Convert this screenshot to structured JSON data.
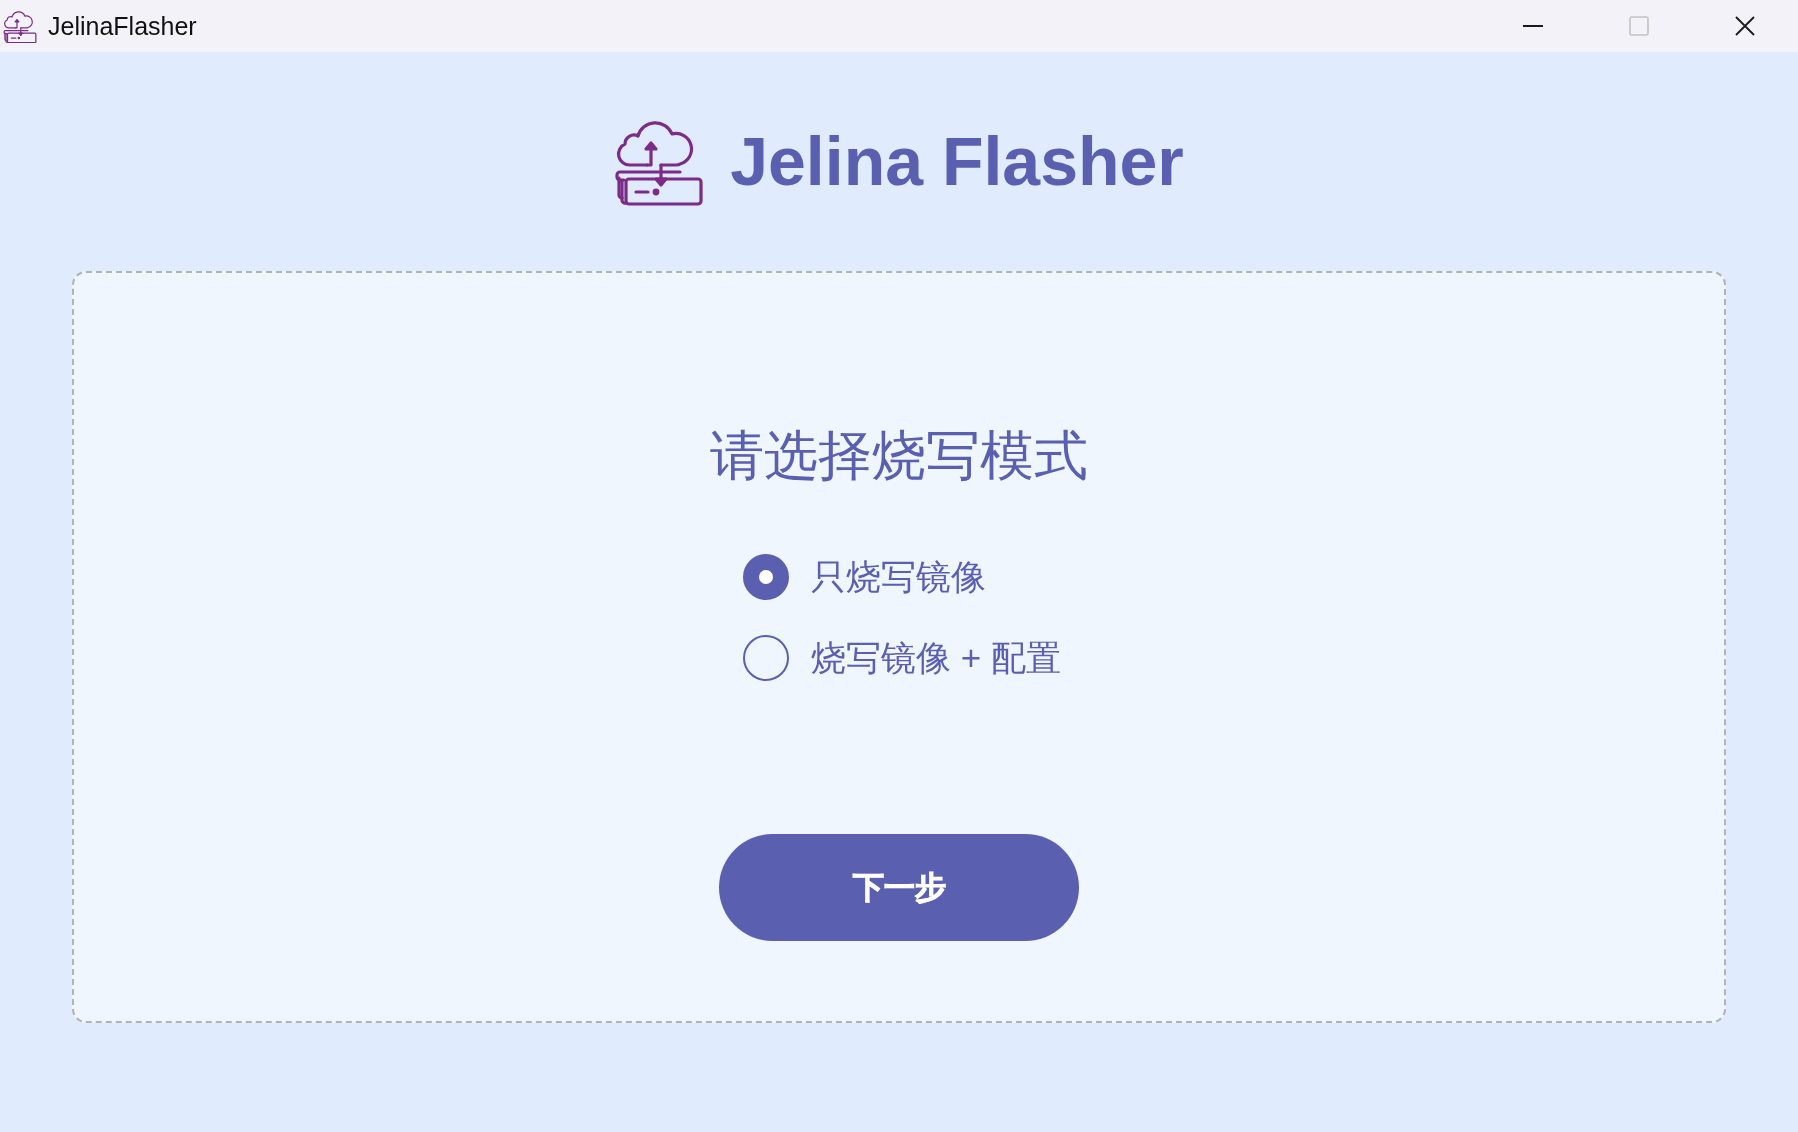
{
  "window": {
    "title": "JelinaFlasher",
    "controls": [
      {
        "kind": "minimize",
        "disabled": false
      },
      {
        "kind": "maximize",
        "disabled": true
      },
      {
        "kind": "close",
        "disabled": false
      }
    ]
  },
  "header": {
    "title": "Jelina Flasher"
  },
  "mode_selection": {
    "heading": "请选择烧写模式",
    "options": [
      {
        "label": "只烧写镜像",
        "selected": true
      },
      {
        "label": "烧写镜像 + 配置",
        "selected": false
      }
    ]
  },
  "next_button": {
    "label": "下一步"
  }
}
